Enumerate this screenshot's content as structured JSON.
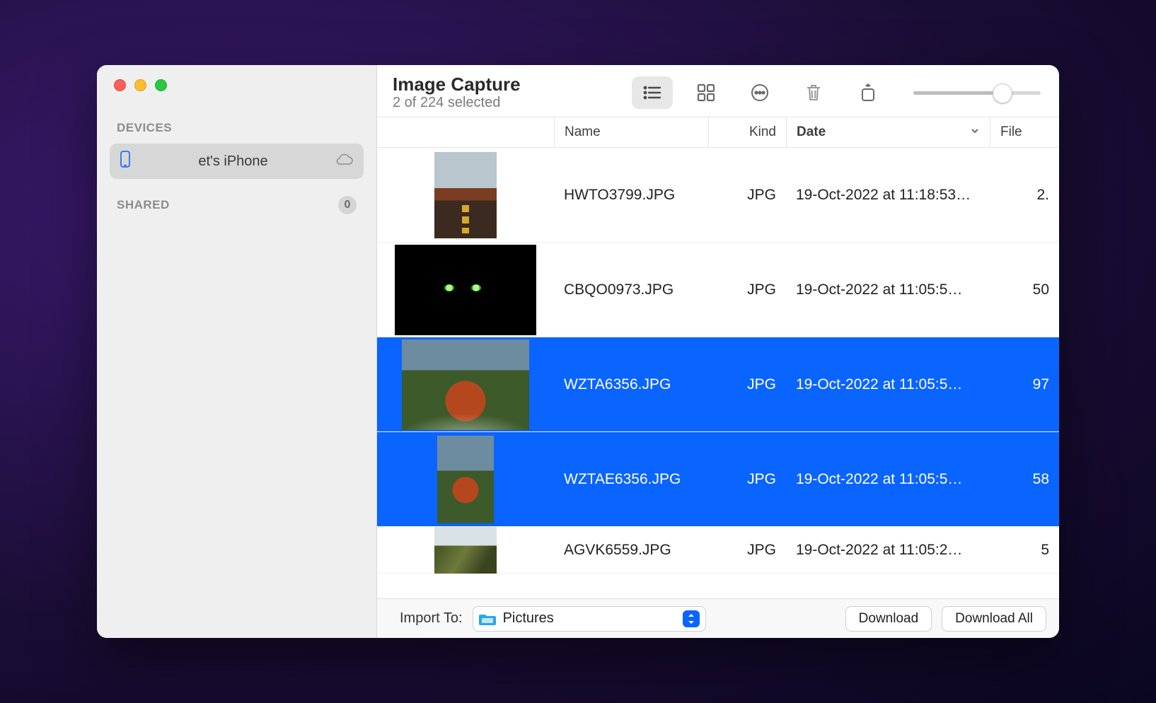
{
  "app": {
    "title": "Image Capture",
    "subtitle": "2 of 224 selected"
  },
  "sidebar": {
    "heading_devices": "DEVICES",
    "heading_shared": "SHARED",
    "device_label": "et's iPhone",
    "shared_count": "0"
  },
  "columns": {
    "name": "Name",
    "kind": "Kind",
    "date": "Date",
    "size": "File"
  },
  "rows": [
    {
      "name": "HWTO3799.JPG",
      "kind": "JPG",
      "date": "19-Oct-2022 at 11:18:53…",
      "size": "2.",
      "selected": false,
      "thumb": "road"
    },
    {
      "name": "CBQO0973.JPG",
      "kind": "JPG",
      "date": "19-Oct-2022 at 11:05:5…",
      "size": "50",
      "selected": false,
      "thumb": "cat"
    },
    {
      "name": "WZTA6356.JPG",
      "kind": "JPG",
      "date": "19-Oct-2022 at 11:05:5…",
      "size": "97",
      "selected": true,
      "thumb": "leaf"
    },
    {
      "name": "WZTAE6356.JPG",
      "kind": "JPG",
      "date": "19-Oct-2022 at 11:05:5…",
      "size": "58",
      "selected": true,
      "thumb": "leaf2"
    },
    {
      "name": "AGVK6559.JPG",
      "kind": "JPG",
      "date": "19-Oct-2022 at 11:05:2…",
      "size": "5",
      "selected": false,
      "thumb": "rock",
      "peek": true
    }
  ],
  "bottom": {
    "import_to_label": "Import To:",
    "destination": "Pictures",
    "download": "Download",
    "download_all": "Download All"
  }
}
